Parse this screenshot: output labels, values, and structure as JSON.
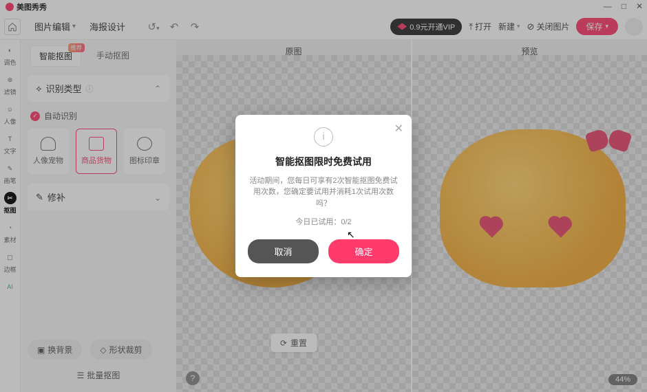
{
  "app": {
    "name": "美图秀秀"
  },
  "window_controls": {
    "min": "—",
    "max": "□",
    "close": "✕"
  },
  "toolbar": {
    "menu": {
      "edit": "图片编辑",
      "poster": "海报设计"
    },
    "history": "",
    "vip_text": "0.9元开通VIP",
    "open": "打开",
    "new": "新建",
    "close_image": "关闭图片",
    "save": "保存"
  },
  "rail": {
    "adjust": "调色",
    "filter": "滤镜",
    "portrait": "人像",
    "text": "文字",
    "brush": "画笔",
    "cutout": "抠图",
    "material": "素材",
    "frame": "边框",
    "ai": ""
  },
  "panel": {
    "tabs": {
      "smart": "智能抠图",
      "manual": "手动抠图",
      "hot": "推荐"
    },
    "section_title": "识别类型",
    "auto_detect": "自动识别",
    "types": {
      "person": "人像宠物",
      "product": "商品货物",
      "icon": "图标印章"
    },
    "edit_section": "修补",
    "change_bg": "换背景",
    "shape_crop": "形状裁剪",
    "batch": "批量抠图"
  },
  "canvas": {
    "left_label": "原图",
    "right_label": "预览",
    "reset": "重置",
    "zoom": "44%"
  },
  "modal": {
    "title": "智能抠图限时免费试用",
    "desc": "活动期间，您每日可享有2次智能抠图免费试用次数，您确定要试用并消耗1次试用次数吗？",
    "count_label": "今日已试用：",
    "count_value": "0/2",
    "cancel": "取消",
    "ok": "确定"
  }
}
